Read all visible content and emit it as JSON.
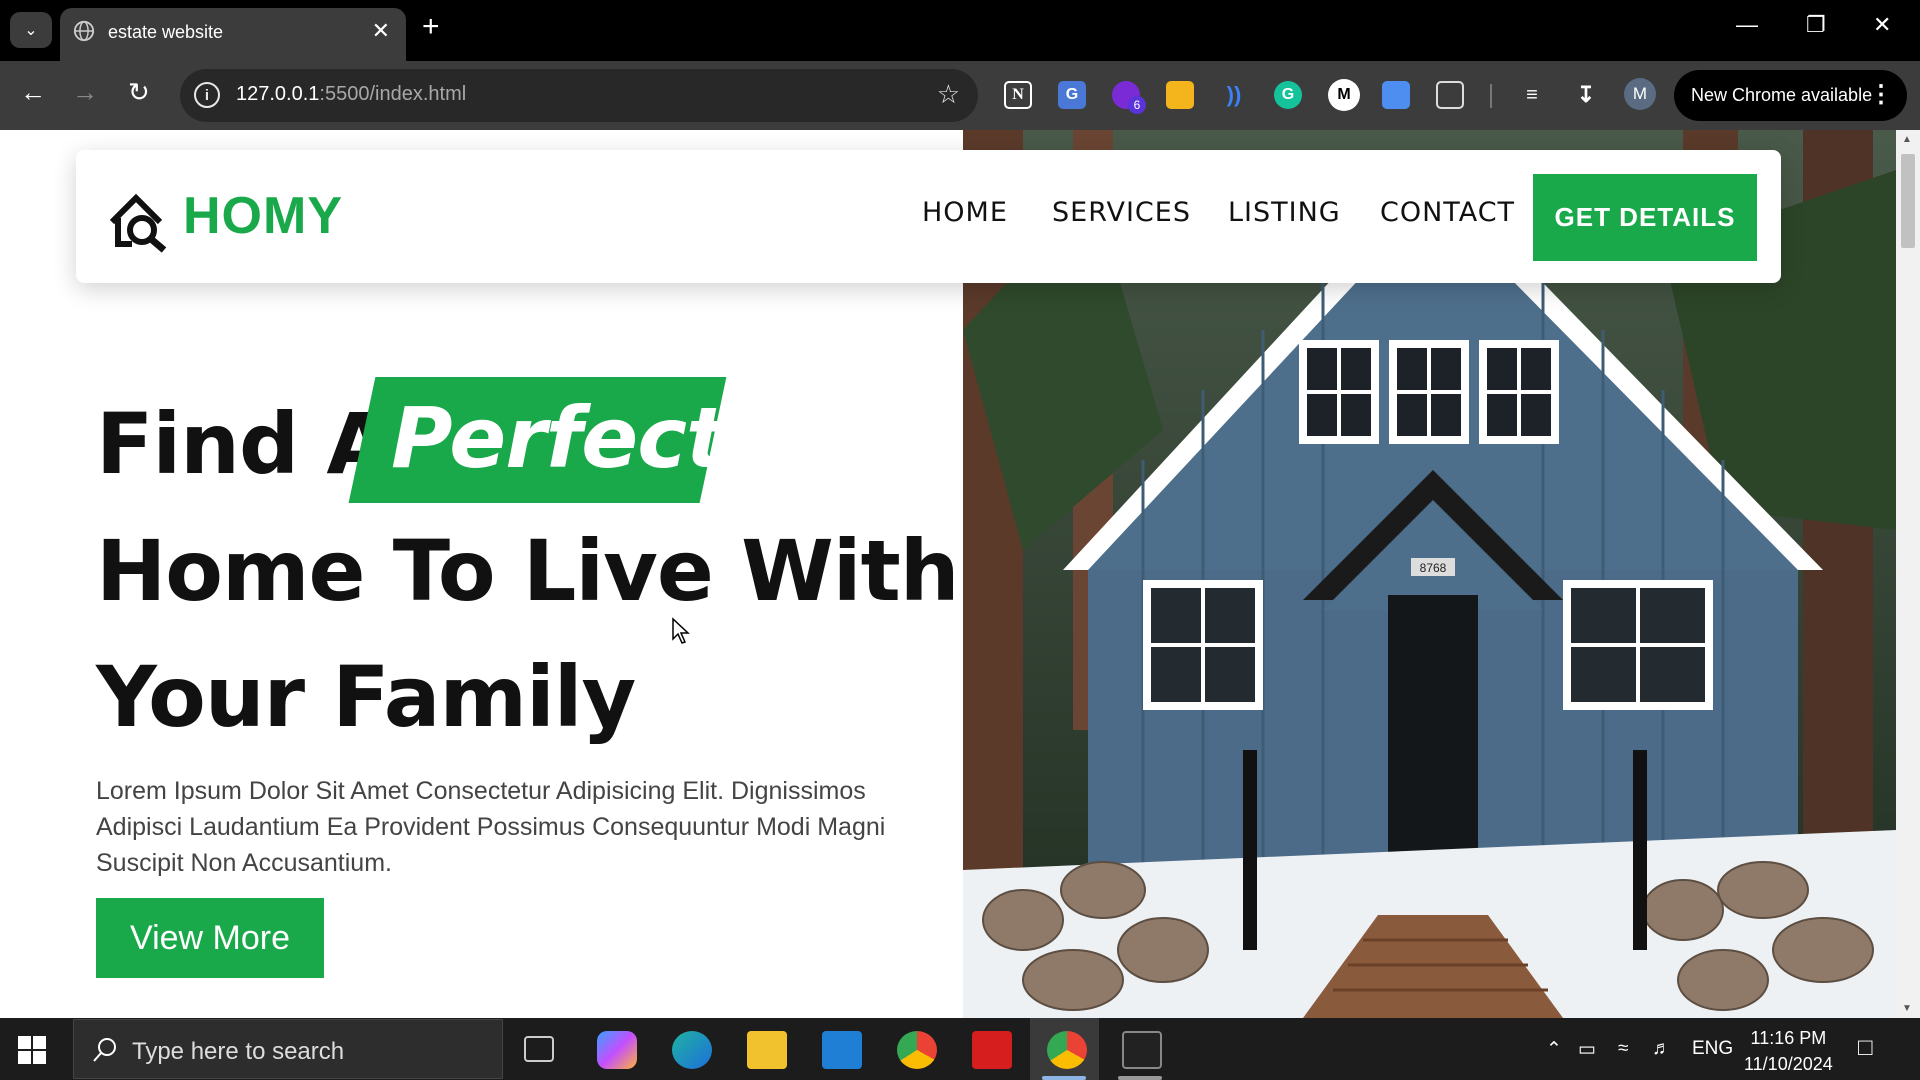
{
  "browser": {
    "tab_title": "estate website",
    "url_host": "127.0.0.1",
    "url_rest": ":5500/index.html",
    "extension_badge": "6",
    "profile_initial": "M",
    "update_label": "New Chrome available"
  },
  "site": {
    "logo_text": "HOMY",
    "nav": [
      "HOME",
      "SERVICES",
      "LISTING",
      "CONTACT"
    ],
    "cta_label": "GET DETAILS",
    "headline_line1_prefix": "Find A",
    "headline_highlight": "Perfect",
    "headline_line2": "Home To Live With",
    "headline_line3": "Your Family",
    "paragraph": "Lorem Ipsum Dolor Sit Amet Consectetur Adipisicing Elit. Dignissimos Adipisci Laudantium Ea Provident Possimus Consequuntur Modi Magni Suscipit Non Accusantium.",
    "button_label": "View More",
    "house_number": "8768",
    "brand_color": "#1aa94a"
  },
  "taskbar": {
    "search_placeholder": "Type here to search",
    "language": "ENG",
    "time": "11:16 PM",
    "date": "11/10/2024"
  }
}
